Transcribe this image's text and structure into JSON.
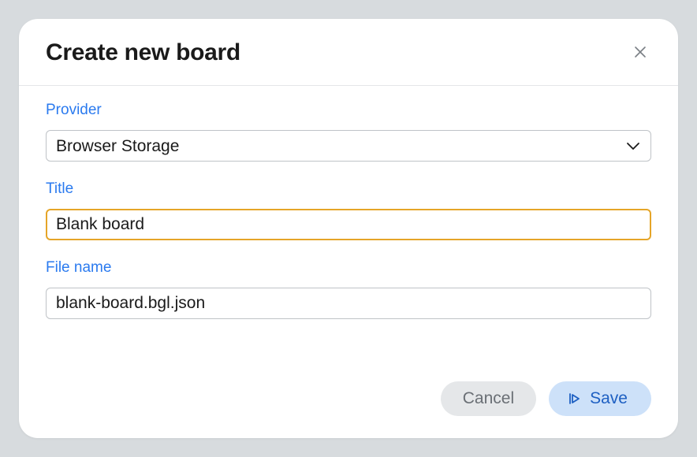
{
  "dialog": {
    "title": "Create new board",
    "fields": {
      "provider": {
        "label": "Provider",
        "value": "Browser Storage"
      },
      "title": {
        "label": "Title",
        "value": "Blank board"
      },
      "filename": {
        "label": "File name",
        "value": "blank-board.bgl.json"
      }
    },
    "actions": {
      "cancel": "Cancel",
      "save": "Save"
    }
  }
}
